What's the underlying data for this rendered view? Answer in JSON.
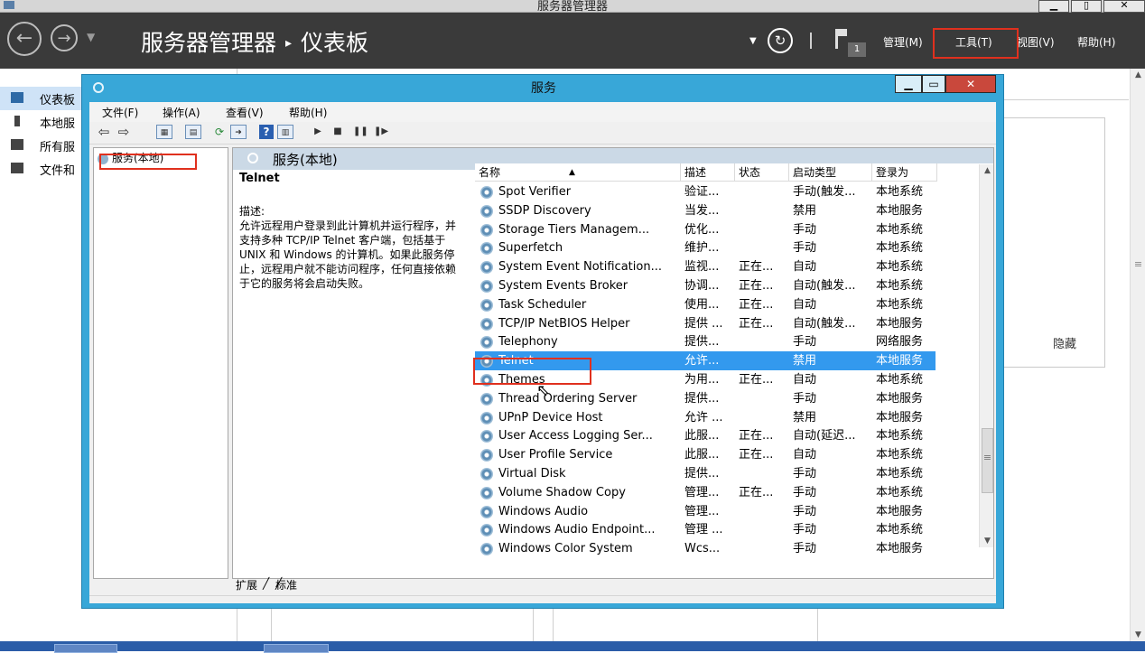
{
  "server_manager": {
    "window_title": "服务器管理器",
    "breadcrumb": {
      "app": "服务器管理器",
      "page": "仪表板"
    },
    "notification_count": "1",
    "menu": {
      "manage": "管理(M)",
      "tools": "工具(T)",
      "view": "视图(V)",
      "help": "帮助(H)"
    },
    "sidebar": [
      {
        "label": "仪表板"
      },
      {
        "label": "本地服"
      },
      {
        "label": "所有服"
      },
      {
        "label": "文件和"
      }
    ],
    "hide_label": "隐藏"
  },
  "services_window": {
    "title": "服务",
    "menu": {
      "file": "文件(F)",
      "action": "操作(A)",
      "view": "查看(V)",
      "help": "帮助(H)"
    },
    "tree_node": "服务(本地)",
    "pane_title": "服务(本地)",
    "selected_service": {
      "name": "Telnet",
      "desc_label": "描述:",
      "description": "允许远程用户登录到此计算机并运行程序，并支持多种 TCP/IP Telnet 客户端，包括基于 UNIX 和 Windows 的计算机。如果此服务停止，远程用户就不能访问程序，任何直接依赖于它的服务将会启动失败。"
    },
    "columns": {
      "name": "名称",
      "desc": "描述",
      "status": "状态",
      "startup": "启动类型",
      "logon": "登录为"
    },
    "rows": [
      {
        "name": "Spot Verifier",
        "desc": "验证...",
        "status": "",
        "startup": "手动(触发...",
        "logon": "本地系统"
      },
      {
        "name": "SSDP Discovery",
        "desc": "当发...",
        "status": "",
        "startup": "禁用",
        "logon": "本地服务"
      },
      {
        "name": "Storage Tiers Managem...",
        "desc": "优化...",
        "status": "",
        "startup": "手动",
        "logon": "本地系统"
      },
      {
        "name": "Superfetch",
        "desc": "维护...",
        "status": "",
        "startup": "手动",
        "logon": "本地系统"
      },
      {
        "name": "System Event Notification...",
        "desc": "监视...",
        "status": "正在...",
        "startup": "自动",
        "logon": "本地系统"
      },
      {
        "name": "System Events Broker",
        "desc": "协调...",
        "status": "正在...",
        "startup": "自动(触发...",
        "logon": "本地系统"
      },
      {
        "name": "Task Scheduler",
        "desc": "使用...",
        "status": "正在...",
        "startup": "自动",
        "logon": "本地系统"
      },
      {
        "name": "TCP/IP NetBIOS Helper",
        "desc": "提供 ...",
        "status": "正在...",
        "startup": "自动(触发...",
        "logon": "本地服务"
      },
      {
        "name": "Telephony",
        "desc": "提供...",
        "status": "",
        "startup": "手动",
        "logon": "网络服务"
      },
      {
        "name": "Telnet",
        "desc": "允许...",
        "status": "",
        "startup": "禁用",
        "logon": "本地服务"
      },
      {
        "name": "Themes",
        "desc": "为用...",
        "status": "正在...",
        "startup": "自动",
        "logon": "本地系统"
      },
      {
        "name": "Thread Ordering Server",
        "desc": "提供...",
        "status": "",
        "startup": "手动",
        "logon": "本地服务"
      },
      {
        "name": "UPnP Device Host",
        "desc": "允许 ...",
        "status": "",
        "startup": "禁用",
        "logon": "本地服务"
      },
      {
        "name": "User Access Logging Ser...",
        "desc": "此服...",
        "status": "正在...",
        "startup": "自动(延迟...",
        "logon": "本地系统"
      },
      {
        "name": "User Profile Service",
        "desc": "此服...",
        "status": "正在...",
        "startup": "自动",
        "logon": "本地系统"
      },
      {
        "name": "Virtual Disk",
        "desc": "提供...",
        "status": "",
        "startup": "手动",
        "logon": "本地系统"
      },
      {
        "name": "Volume Shadow Copy",
        "desc": "管理...",
        "status": "正在...",
        "startup": "手动",
        "logon": "本地系统"
      },
      {
        "name": "Windows Audio",
        "desc": "管理...",
        "status": "",
        "startup": "手动",
        "logon": "本地服务"
      },
      {
        "name": "Windows Audio Endpoint...",
        "desc": "管理 ...",
        "status": "",
        "startup": "手动",
        "logon": "本地系统"
      },
      {
        "name": "Windows Color System",
        "desc": "Wcs...",
        "status": "",
        "startup": "手动",
        "logon": "本地服务"
      }
    ],
    "selected_row_index": 9,
    "tabs": {
      "extended": "扩展",
      "standard": "标准"
    }
  }
}
